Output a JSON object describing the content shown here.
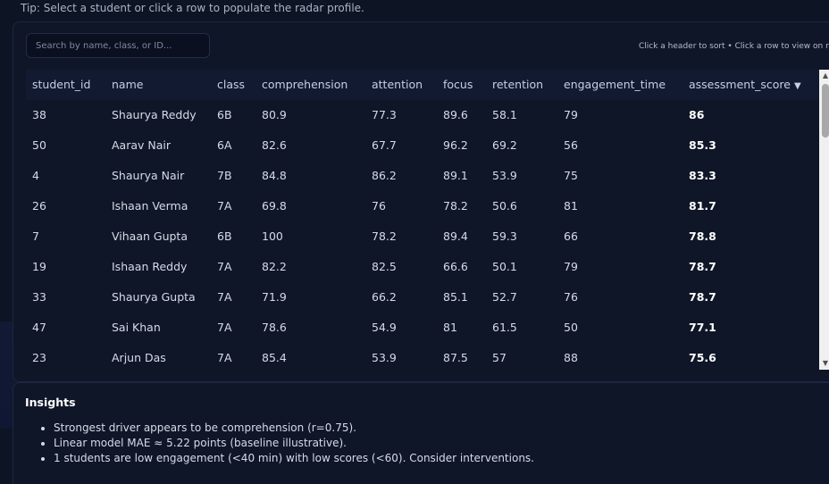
{
  "tip": "Tip: Select a student or click a row to populate the radar profile.",
  "search": {
    "placeholder": "Search by name, class, or ID..."
  },
  "hint": "Click a header to sort • Click a row to view on radar",
  "table": {
    "columns": [
      "student_id",
      "name",
      "class",
      "comprehension",
      "attention",
      "focus",
      "retention",
      "engagement_time",
      "assessment_score"
    ],
    "sorted_column": "assessment_score",
    "sort_indicator": "▼",
    "rows": [
      [
        "38",
        "Shaurya Reddy",
        "6B",
        "80.9",
        "77.3",
        "89.6",
        "58.1",
        "79",
        "86"
      ],
      [
        "50",
        "Aarav Nair",
        "6A",
        "82.6",
        "67.7",
        "96.2",
        "69.2",
        "56",
        "85.3"
      ],
      [
        "4",
        "Shaurya Nair",
        "7B",
        "84.8",
        "86.2",
        "89.1",
        "53.9",
        "75",
        "83.3"
      ],
      [
        "26",
        "Ishaan Verma",
        "7A",
        "69.8",
        "76",
        "78.2",
        "50.6",
        "81",
        "81.7"
      ],
      [
        "7",
        "Vihaan Gupta",
        "6B",
        "100",
        "78.2",
        "89.4",
        "59.3",
        "66",
        "78.8"
      ],
      [
        "19",
        "Ishaan Reddy",
        "7A",
        "82.2",
        "82.5",
        "66.6",
        "50.1",
        "79",
        "78.7"
      ],
      [
        "33",
        "Shaurya Gupta",
        "7A",
        "71.9",
        "66.2",
        "85.1",
        "52.7",
        "76",
        "78.7"
      ],
      [
        "47",
        "Sai Khan",
        "7A",
        "78.6",
        "54.9",
        "81",
        "61.5",
        "50",
        "77.1"
      ],
      [
        "23",
        "Arjun Das",
        "7A",
        "85.4",
        "53.9",
        "87.5",
        "57",
        "88",
        "75.6"
      ]
    ]
  },
  "scrollbar": {
    "up_arrow": "▲",
    "down_arrow": "▼"
  },
  "insights": {
    "title": "Insights",
    "items": [
      "Strongest driver appears to be comprehension (r=0.75).",
      "Linear model MAE ≈ 5.22 points (baseline illustrative).",
      "1 students are low engagement (<40 min) with low scores (<60). Consider interventions."
    ]
  }
}
